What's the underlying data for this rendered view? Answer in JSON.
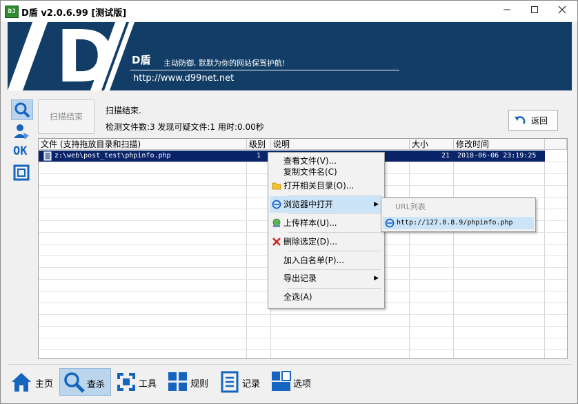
{
  "window": {
    "title": "D盾 v2.0.6.99 [测试版]",
    "app_icon_text": "DJ",
    "buttons": [
      "minimize",
      "maximize",
      "close"
    ]
  },
  "banner": {
    "logo_text": "D",
    "product_name": "D盾",
    "slogan": "主动防御, 默默为你的网站保驾护航!",
    "url": "http://www.d99net.net",
    "background": "#123d66"
  },
  "sidebar": {
    "items": [
      {
        "name": "search",
        "icon": "search-icon",
        "selected": true
      },
      {
        "name": "user",
        "icon": "user-icon",
        "selected": false
      },
      {
        "name": "ok",
        "icon": "ok-icon",
        "text": "OK",
        "selected": false
      },
      {
        "name": "window",
        "icon": "window-icon",
        "selected": false
      }
    ]
  },
  "scan": {
    "finish_button": "扫描结束",
    "status_line1": "扫描结束.",
    "status_line2": "检测文件数:3 发现可疑文件:1 用时:0.00秒",
    "back_button": "返回"
  },
  "table": {
    "headers": [
      "文件 (支持拖放目录和扫描)",
      "级别",
      "说明",
      "大小",
      "修改时间"
    ],
    "rows": [
      {
        "file": "z:\\web\\post_test\\phpinfo.php",
        "level": "1",
        "desc": "",
        "size": "21",
        "modified": "2018-06-06 23:19:25",
        "selected": true
      }
    ]
  },
  "context_menu": {
    "items": [
      {
        "label": "查看文件(V)...",
        "icon": ""
      },
      {
        "label": "复制文件名(C)",
        "icon": ""
      },
      {
        "label": "打开相关目录(O)...",
        "icon": "folder-icon"
      },
      {
        "label": "浏览器中打开",
        "icon": "ie-icon",
        "submenu": true,
        "highlighted": true
      },
      {
        "label": "上传样本(U)...",
        "icon": "upload-icon"
      },
      {
        "label": "删除选定(D)...",
        "icon": "delete-icon"
      },
      {
        "label": "加入白名单(P)...",
        "icon": ""
      },
      {
        "label": "导出记录",
        "icon": "",
        "submenu": true
      },
      {
        "label": "全选(A)",
        "icon": ""
      }
    ],
    "submenu": {
      "header": "URL列表",
      "items": [
        "http://127.0.8.9/phpinfo.php"
      ]
    }
  },
  "bottom_toolbar": {
    "items": [
      {
        "label": "主页",
        "icon": "home-icon",
        "selected": false
      },
      {
        "label": "查杀",
        "icon": "search-icon",
        "selected": true
      },
      {
        "label": "工具",
        "icon": "tools-icon",
        "selected": false
      },
      {
        "label": "规则",
        "icon": "rules-icon",
        "selected": false
      },
      {
        "label": "记录",
        "icon": "log-icon",
        "selected": false
      },
      {
        "label": "选项",
        "icon": "options-icon",
        "selected": false
      }
    ]
  },
  "colors": {
    "accent": "#1565c0",
    "selection": "#0a246a",
    "menu_highlight": "#cce4f7",
    "delete_red": "#d42020"
  }
}
